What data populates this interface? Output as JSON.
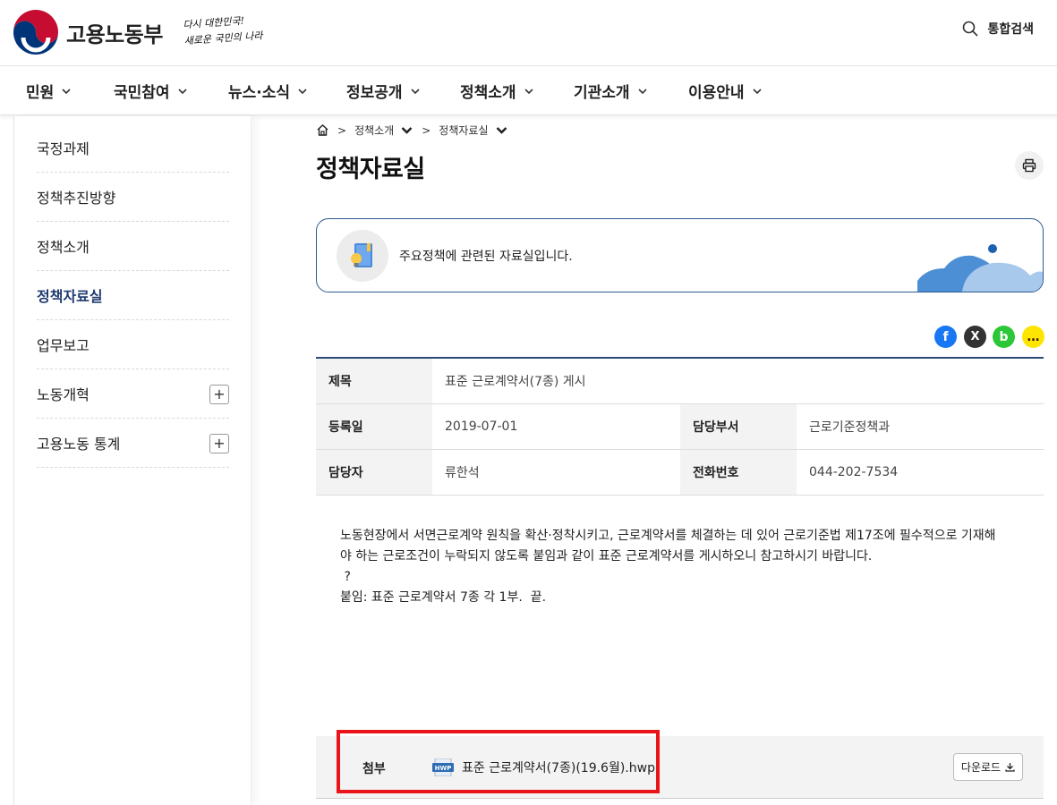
{
  "header": {
    "logo_text": "고용노동부",
    "slogan_line1": "다시 대한민국!",
    "slogan_line2": "새로운 국민의 나라",
    "search_label": "통합검색"
  },
  "gnb": [
    "민원",
    "국민참여",
    "뉴스·소식",
    "정보공개",
    "정책소개",
    "기관소개",
    "이용안내"
  ],
  "sidebar": {
    "items": [
      {
        "label": "국정과제"
      },
      {
        "label": "정책추진방향"
      },
      {
        "label": "정책소개"
      },
      {
        "label": "정책자료실"
      },
      {
        "label": "업무보고"
      },
      {
        "label": "노동개혁",
        "expand": "+"
      },
      {
        "label": "고용노동 통계",
        "expand": "+"
      }
    ],
    "active": "정책자료실"
  },
  "breadcrumb": {
    "sep1": ">",
    "item1": "정책소개",
    "sep2": ">",
    "item2": "정책자료실"
  },
  "page_title": "정책자료실",
  "info_box": {
    "text": "주요정책에 관련된 자료실입니다."
  },
  "share": {
    "facebook": "f",
    "x": "X",
    "band": "b",
    "kakaotalk": "…"
  },
  "meta": {
    "title_label": "제목",
    "title_value": "표준 근로계약서(7종) 게시",
    "date_label": "등록일",
    "date_value": "2019-07-01",
    "dept_label": "담당부서",
    "dept_value": "근로기준정책과",
    "person_label": "담당자",
    "person_value": "류한석",
    "phone_label": "전화번호",
    "phone_value": "044-202-7534"
  },
  "body": {
    "line1": "노동현장에서 서면근로계약 원칙을 확산·정착시키고, 근로계약서를 체결하는 데 있어 근로기준법 제17조에 필수적으로 기재해",
    "line2": "야 하는 근로조건이 누락되지 않도록 붙임과 같이 표준 근로계약서를 게시하오니 참고하시기 바랍니다.",
    "line3": " ?",
    "line4": "붙임: 표준 근로계약서 7종 각 1부.  끝."
  },
  "attachment": {
    "label": "첨부",
    "file_type": "HWP",
    "file_name": "표준 근로계약서(7종)(19.6월).hwp",
    "download_label": "다운로드"
  },
  "colors": {
    "primary_navy": "#1e3a6e",
    "table_border": "#2a4a78",
    "highlight_red": "#e8141a",
    "facebook": "#1877f2",
    "x": "#333333",
    "band": "#2bc737",
    "kakao": "#fee500"
  }
}
